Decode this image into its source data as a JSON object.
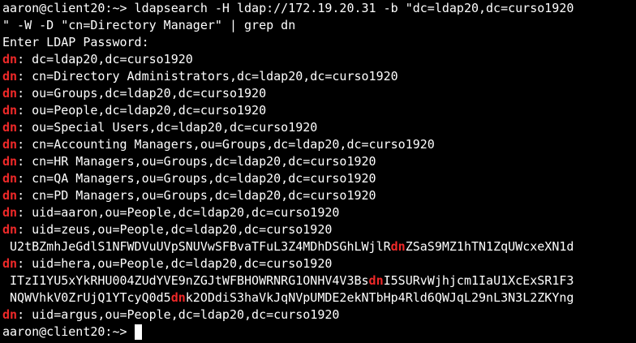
{
  "terminal": {
    "prompt_text": "aaron@client20:~> ",
    "colors": {
      "background": "#000000",
      "foreground": "#ffffff",
      "match_highlight": "#ef2929"
    },
    "lines": [
      [
        {
          "t": "aaron@client20:~> ldapsearch -H ldap://172.19.20.31 -b \"dc=ldap20,dc=curso1920"
        }
      ],
      [
        {
          "t": "\" -W -D \"cn=Directory Manager\" | grep dn"
        }
      ],
      [
        {
          "t": "Enter LDAP Password:"
        }
      ],
      [
        {
          "t": "dn",
          "h": true
        },
        {
          "t": ": dc=ldap20,dc=curso1920"
        }
      ],
      [
        {
          "t": "dn",
          "h": true
        },
        {
          "t": ": cn=Directory Administrators,dc=ldap20,dc=curso1920"
        }
      ],
      [
        {
          "t": "dn",
          "h": true
        },
        {
          "t": ": ou=Groups,dc=ldap20,dc=curso1920"
        }
      ],
      [
        {
          "t": "dn",
          "h": true
        },
        {
          "t": ": ou=People,dc=ldap20,dc=curso1920"
        }
      ],
      [
        {
          "t": "dn",
          "h": true
        },
        {
          "t": ": ou=Special Users,dc=ldap20,dc=curso1920"
        }
      ],
      [
        {
          "t": "dn",
          "h": true
        },
        {
          "t": ": cn=Accounting Managers,ou=Groups,dc=ldap20,dc=curso1920"
        }
      ],
      [
        {
          "t": "dn",
          "h": true
        },
        {
          "t": ": cn=HR Managers,ou=Groups,dc=ldap20,dc=curso1920"
        }
      ],
      [
        {
          "t": "dn",
          "h": true
        },
        {
          "t": ": cn=QA Managers,ou=Groups,dc=ldap20,dc=curso1920"
        }
      ],
      [
        {
          "t": "dn",
          "h": true
        },
        {
          "t": ": cn=PD Managers,ou=Groups,dc=ldap20,dc=curso1920"
        }
      ],
      [
        {
          "t": "dn",
          "h": true
        },
        {
          "t": ": uid=aaron,ou=People,dc=ldap20,dc=curso1920"
        }
      ],
      [
        {
          "t": "dn",
          "h": true
        },
        {
          "t": ": uid=zeus,ou=People,dc=ldap20,dc=curso1920"
        }
      ],
      [
        {
          "t": " U2tBZmhJeGdlS1NFWDVuUVpSNUVwSFBvaTFuL3Z4MDhDSGhLWjlR"
        },
        {
          "t": "dn",
          "h": true
        },
        {
          "t": "ZSaS9MZ1hTN1ZqUWcxeXN1d"
        }
      ],
      [
        {
          "t": "dn",
          "h": true
        },
        {
          "t": ": uid=hera,ou=People,dc=ldap20,dc=curso1920"
        }
      ],
      [
        {
          "t": " ITzI1YU5xYkRHU004ZUdYVE9nZGJtWFBHOWRNRG1ONHV4V3Bs"
        },
        {
          "t": "dn",
          "h": true
        },
        {
          "t": "I5SURvWjhjcm1IaU1XcExSR1F3"
        }
      ],
      [
        {
          "t": " NQWVhkV0ZrUjQ1YTcyQ0d5"
        },
        {
          "t": "dn",
          "h": true
        },
        {
          "t": "k2ODdiS3haVkJqNVpUMDE2ekNTbHp4Rld6QWJqL29nL3N3L2ZKYng"
        }
      ],
      [
        {
          "t": "dn",
          "h": true
        },
        {
          "t": ": uid=argus,ou=People,dc=ldap20,dc=curso1920"
        }
      ]
    ]
  }
}
